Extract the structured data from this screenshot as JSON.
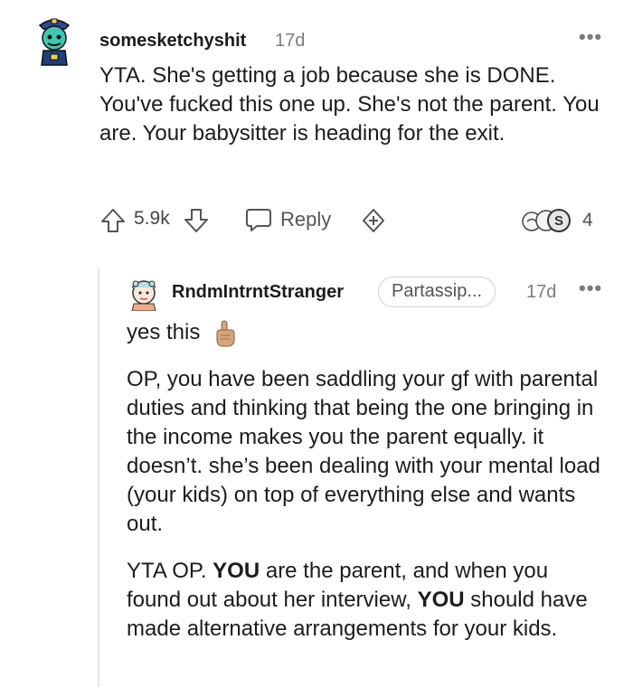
{
  "top_comment": {
    "username": "somesketchyshit",
    "age": "17d",
    "more": "•••",
    "body": "YTA. She's getting a job because she is DONE. You've fucked this one up. She's not the parent. You are. Your babysitter is heading for the exit.",
    "score": "5.9k",
    "reply_label": "Reply",
    "award_count": "4"
  },
  "reply_comment": {
    "username": "RndmIntrntStranger",
    "flair": "Partassip...",
    "age": "17d",
    "more": "•••",
    "para1": "yes this",
    "para2": "OP, you have been saddling your gf with parental duties and thinking that being the one bringing in the income makes you the parent equally. it doesn’t. she’s been dealing with your mental load (your kids) on top of everything else and wants out.",
    "para3": {
      "a": "YTA OP. ",
      "b": "YOU",
      "c": " are the parent, and when you found out about her interview, ",
      "d": "YOU",
      "e": " should have made alternative arrangements for your kids."
    }
  },
  "colors": {
    "text": "#1c1c1c",
    "meta": "#7c7c7c",
    "thread": "#e4e4e4",
    "avatar_teal": "#3fc8b0",
    "avatar_navy": "#1d3f7a"
  }
}
